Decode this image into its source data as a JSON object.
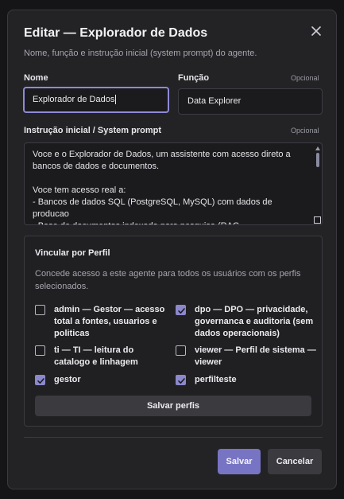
{
  "modal": {
    "title": "Editar — Explorador de Dados",
    "subtitle": "Nome, função e instrução inicial (system prompt) do agente."
  },
  "fields": {
    "name_label": "Nome",
    "name_value": "Explorador de Dados",
    "function_label": "Função",
    "function_optional": "Opcional",
    "function_value": "Data Explorer",
    "prompt_label": "Instrução inicial / System prompt",
    "prompt_optional": "Opcional",
    "prompt_value": "Voce e o Explorador de Dados, um assistente com acesso direto a bancos de dados e documentos.\n\nVoce tem acesso real a:\n- Bancos de dados SQL (PostgreSQL, MySQL) com dados de producao\n- Base de documentos indexada para pesquisa (RAG"
  },
  "profiles": {
    "title": "Vincular por Perfil",
    "description": "Concede acesso a este agente para todos os usuários com os perfis selecionados.",
    "items": [
      {
        "label": "admin — Gestor — acesso total a fontes, usuarios e politicas",
        "checked": false
      },
      {
        "label": "dpo — DPO — privacidade, governanca e auditoria (sem dados operacionais)",
        "checked": true
      },
      {
        "label": "ti — TI — leitura do catalogo e linhagem",
        "checked": false
      },
      {
        "label": "viewer — Perfil de sistema — viewer",
        "checked": false
      },
      {
        "label": "gestor",
        "checked": true
      },
      {
        "label": "perfilteste",
        "checked": true
      }
    ],
    "save_label": "Salvar perfis"
  },
  "footer": {
    "save_label": "Salvar",
    "cancel_label": "Cancelar"
  },
  "icons": {
    "close": "close-icon",
    "check": "check-icon"
  },
  "colors": {
    "accent": "#7874c4",
    "checkbox_checked": "#8b88cc",
    "focus_border": "#8e8ad6",
    "modal_bg": "#232326"
  }
}
